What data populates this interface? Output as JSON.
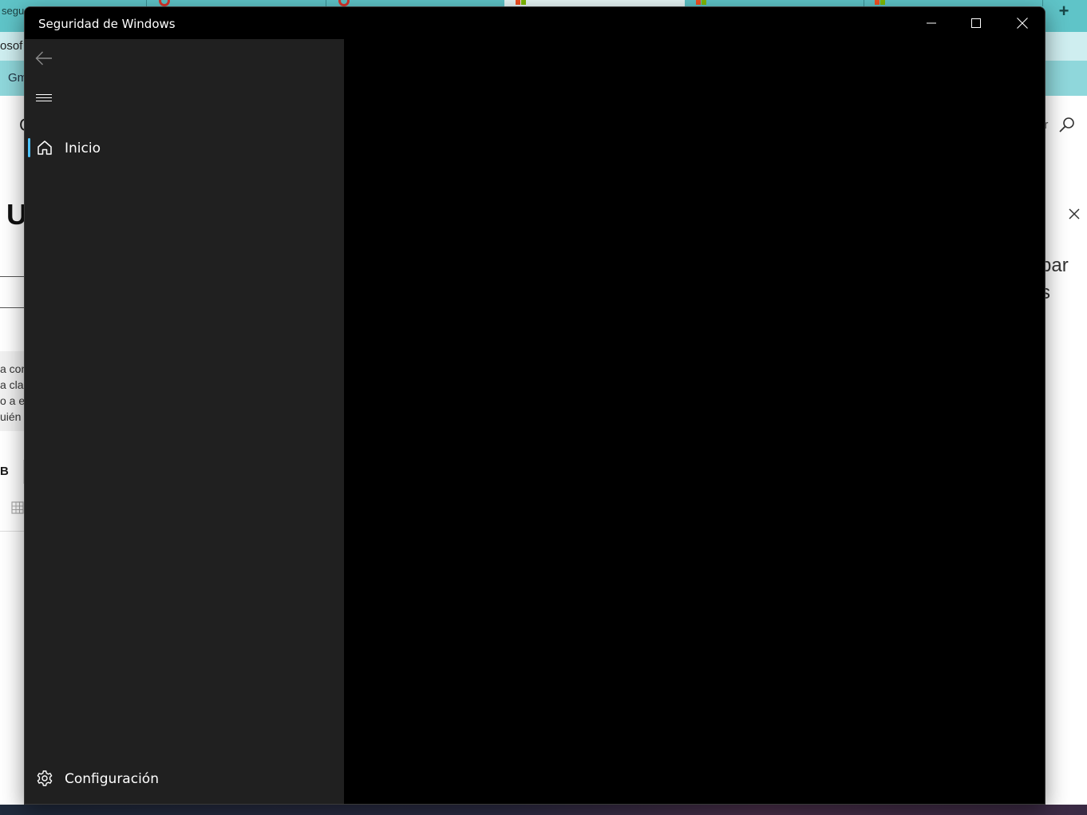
{
  "window": {
    "title": "Seguridad de Windows",
    "caption_buttons": [
      "minimize-icon",
      "maximize-icon",
      "close-icon"
    ]
  },
  "nav": {
    "back_icon": "back-arrow-icon",
    "menu_icon": "hamburger-menu-icon",
    "items": [
      {
        "label": "Inicio",
        "icon": "home-icon",
        "selected": true
      }
    ],
    "footer": {
      "label": "Configuración",
      "icon": "gear-icon"
    }
  },
  "background_browser": {
    "tab_fragment": "segu",
    "address_fragment": "osof",
    "bookmark_fragment": "Gm",
    "header_letter": "C",
    "search_fragment": "ar",
    "heading_fragment": "U",
    "right_text_fragment": [
      "par",
      "s"
    ],
    "paragraph_fragments": [
      "a cor",
      "a cla",
      "o a e",
      "uién"
    ],
    "toolbar_fragment": "B"
  },
  "colors": {
    "accent": "#4cc2ff",
    "nav_background": "#202020",
    "content_background": "#000000",
    "browser_tabstrip": "#5fc4c8"
  }
}
